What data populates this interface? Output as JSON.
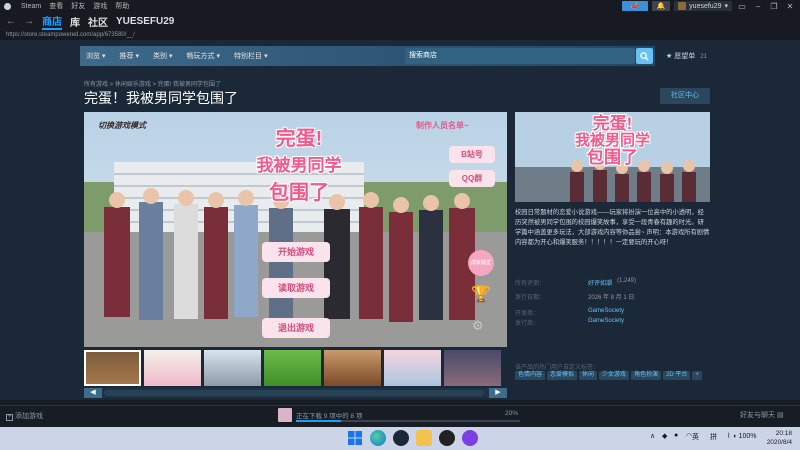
{
  "window": {
    "app_name": "Steam",
    "menu": [
      "查看",
      "好友",
      "游戏",
      "帮助"
    ],
    "username": "yuesefu29"
  },
  "nav": {
    "tabs": [
      {
        "label": "商店",
        "active": true
      },
      {
        "label": "库",
        "active": false
      },
      {
        "label": "社区",
        "active": false
      },
      {
        "label": "YUESEFU29",
        "active": false
      }
    ],
    "url": "https://store.steampowered.com/app/673580/__/"
  },
  "store_nav": {
    "items": [
      "浏览",
      "推荐",
      "类别",
      "畅玩方式",
      "特别栏目"
    ],
    "search_placeholder": "搜索商店",
    "wishlist_label": "愿望单",
    "wishlist_count": "21"
  },
  "page": {
    "breadcrumb": "所有游戏 > 休闲娱乐游戏 > 完蛋! 我被男同学包围了",
    "title": "完蛋！我被男同学包围了",
    "community_hub": "社区中心"
  },
  "main_media": {
    "tl_label": "切换游戏模式",
    "tr_label": "制作人员名单~",
    "headline_l1": "完蛋!",
    "headline_l2": "我被男同学",
    "headline_l3": "包围了",
    "menu_buttons": [
      "开始游戏",
      "读取游戏",
      "退出游戏"
    ],
    "side_buttons": [
      "B站号",
      "QQ群"
    ],
    "side_badge": "成就殿堂"
  },
  "capsule": {
    "line1": "完蛋!",
    "line2": "我被男同学",
    "line3": "包围了"
  },
  "description": "校园日常题材的恋爱小说游戏——玩家将扮演一位高中的小透明，经历突然被男同学包围的校园爆笑故事，享受一段青春有趣的时光。研学篇中涵盖更多玩法，大部游戏内容等你品尝~ 声明：本游戏所有剧情内容都为开心和爆笑服务！！！！！一定要玩的开心呀！",
  "info": {
    "reviews_label": "所有评测：",
    "reviews_value": "好评如潮",
    "reviews_count": "(1,249)",
    "release_label": "发行日期：",
    "release_value": "2026 年 8 月 1 日",
    "developer_label": "开发商：",
    "developer_value": "GameSociety",
    "publisher_label": "发行商：",
    "publisher_value": "GameSociety"
  },
  "tags_label": "该产品的热门用户自定义标签：",
  "tags": [
    "色情内容",
    "恋爱模拟",
    "休闲",
    "少女游戏",
    "角色扮演",
    "2D 平台",
    "+"
  ],
  "bottom": {
    "add_game": "添加游戏",
    "download_text": "正在下载 9 项中的 8 项",
    "download_percent": "20%",
    "download_fraction": 0.2,
    "friends_chat": "好友与聊天"
  },
  "taskbar": {
    "lang": "英",
    "ime": "拼",
    "battery": "100%",
    "time": "20:18",
    "date": "2020/8/4"
  },
  "colors": {
    "accent": "#1a9fff",
    "store_bg": "#1b2838",
    "link": "#66c0f4"
  }
}
